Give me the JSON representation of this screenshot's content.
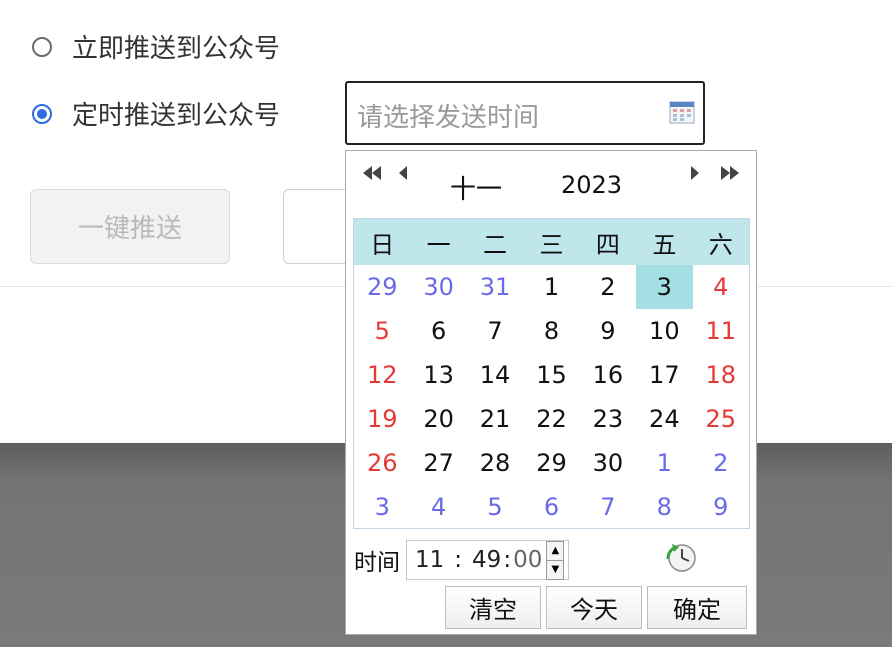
{
  "push_options": {
    "immediate_label": "立即推送到公众号",
    "scheduled_label": "定时推送到公众号",
    "selected": "scheduled"
  },
  "schedule_input": {
    "placeholder": "请选择发送时间",
    "icon": "calendar-icon"
  },
  "buttons": {
    "push_now": "一键推送"
  },
  "datepicker": {
    "nav": {
      "prev_year": "◀◀",
      "prev_month": "◀",
      "next_month": "▶",
      "next_year": "▶▶",
      "month": "十一",
      "year": "2023"
    },
    "weekdays": [
      "日",
      "一",
      "二",
      "三",
      "四",
      "五",
      "六"
    ],
    "weeks": [
      [
        {
          "d": "29",
          "t": "oth"
        },
        {
          "d": "30",
          "t": "oth"
        },
        {
          "d": "31",
          "t": "oth"
        },
        {
          "d": "1",
          "t": "cur"
        },
        {
          "d": "2",
          "t": "cur"
        },
        {
          "d": "3",
          "t": "sel"
        },
        {
          "d": "4",
          "t": "we"
        }
      ],
      [
        {
          "d": "5",
          "t": "we"
        },
        {
          "d": "6",
          "t": "cur"
        },
        {
          "d": "7",
          "t": "cur"
        },
        {
          "d": "8",
          "t": "cur"
        },
        {
          "d": "9",
          "t": "cur"
        },
        {
          "d": "10",
          "t": "cur"
        },
        {
          "d": "11",
          "t": "we"
        }
      ],
      [
        {
          "d": "12",
          "t": "we"
        },
        {
          "d": "13",
          "t": "cur"
        },
        {
          "d": "14",
          "t": "cur"
        },
        {
          "d": "15",
          "t": "cur"
        },
        {
          "d": "16",
          "t": "cur"
        },
        {
          "d": "17",
          "t": "cur"
        },
        {
          "d": "18",
          "t": "we"
        }
      ],
      [
        {
          "d": "19",
          "t": "we"
        },
        {
          "d": "20",
          "t": "cur"
        },
        {
          "d": "21",
          "t": "cur"
        },
        {
          "d": "22",
          "t": "cur"
        },
        {
          "d": "23",
          "t": "cur"
        },
        {
          "d": "24",
          "t": "cur"
        },
        {
          "d": "25",
          "t": "we"
        }
      ],
      [
        {
          "d": "26",
          "t": "we"
        },
        {
          "d": "27",
          "t": "cur"
        },
        {
          "d": "28",
          "t": "cur"
        },
        {
          "d": "29",
          "t": "cur"
        },
        {
          "d": "30",
          "t": "cur"
        },
        {
          "d": "1",
          "t": "oth"
        },
        {
          "d": "2",
          "t": "oth"
        }
      ],
      [
        {
          "d": "3",
          "t": "oth"
        },
        {
          "d": "4",
          "t": "oth"
        },
        {
          "d": "5",
          "t": "oth"
        },
        {
          "d": "6",
          "t": "oth"
        },
        {
          "d": "7",
          "t": "oth"
        },
        {
          "d": "8",
          "t": "oth"
        },
        {
          "d": "9",
          "t": "oth"
        }
      ]
    ],
    "time": {
      "label": "时间",
      "hour": "11",
      "minute": "49",
      "second": "00",
      "separator": ":"
    },
    "actions": {
      "clear": "清空",
      "today": "今天",
      "confirm": "确定"
    },
    "colors": {
      "weekend": "#e53935",
      "other_month": "#6a6ae8",
      "selected_bg": "#a3dfe3",
      "header_bg": "#bfe6ea"
    }
  }
}
